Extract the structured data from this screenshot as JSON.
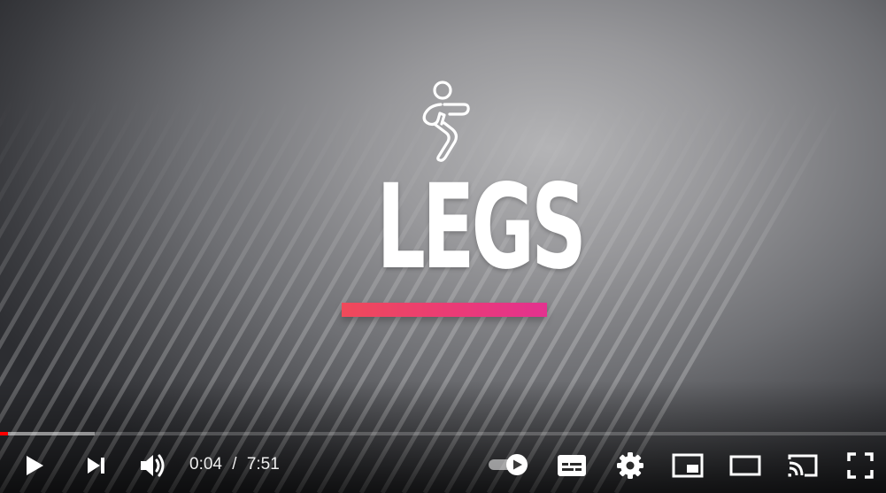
{
  "video": {
    "title_text": "LEGS",
    "title_icon": "squat-figure-icon",
    "accent_gradient": [
      "#ef4a5a",
      "#e3318f"
    ]
  },
  "player": {
    "current_time": "0:04",
    "separator": "/",
    "duration": "7:51",
    "played_fraction": 0.0085,
    "buffered_fraction": 0.107,
    "progress_color": "#ff0000",
    "autoplay_on": true
  },
  "controls": {
    "left": [
      "play-icon",
      "next-icon",
      "volume-icon"
    ],
    "right": [
      "autoplay-toggle",
      "subtitles-icon",
      "settings-icon",
      "miniplayer-icon",
      "theater-mode-icon",
      "cast-icon",
      "fullscreen-icon"
    ]
  }
}
